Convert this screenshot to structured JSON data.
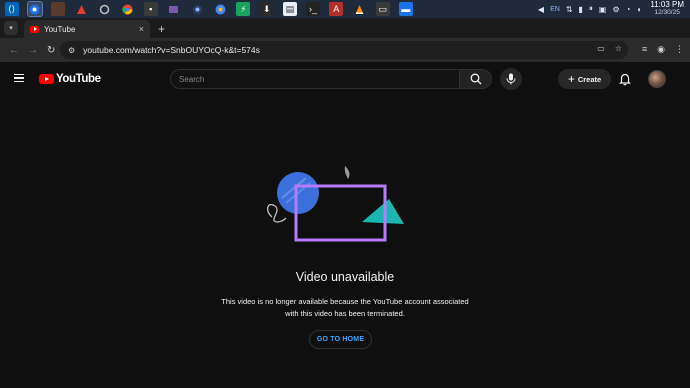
{
  "taskbar": {
    "app_icons": [
      "vscode-icon",
      "chrome-icon",
      "app3-icon",
      "red-triangle-icon",
      "chrome-color-icon",
      "app6-icon",
      "app7-icon",
      "app8-icon",
      "app9-icon",
      "app10-icon",
      "app11-icon",
      "app12-icon",
      "app13-icon",
      "terminal-icon",
      "app15-icon",
      "vlc-icon",
      "app17-icon",
      "app18-icon"
    ],
    "language": "EN",
    "time": "11:03 PM",
    "date": "12/30/25"
  },
  "browser": {
    "tab_title": "YouTube",
    "url": "youtube.com/watch?v=SnbOUYOcQ-k&t=574s"
  },
  "youtube": {
    "logo_text": "YouTube",
    "search_placeholder": "Search",
    "create_label": "Create"
  },
  "content": {
    "title": "Video unavailable",
    "message": "This video is no longer available because the YouTube account associated with this video has been terminated.",
    "button_label": "GO TO HOME"
  },
  "colors": {
    "background": "#0f0f0f",
    "youtube_red": "#ff0000",
    "link_blue": "#3ea6ff",
    "highlight_box": "#b57bff"
  }
}
